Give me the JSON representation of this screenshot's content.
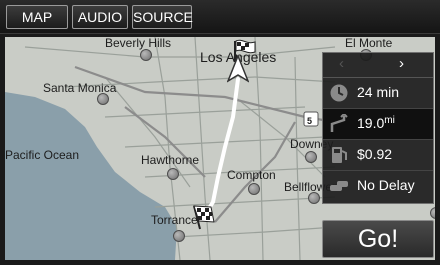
{
  "tabs": [
    {
      "label": "MAP"
    },
    {
      "label": "AUDIO"
    },
    {
      "label": "SOURCE"
    }
  ],
  "map": {
    "cities": [
      {
        "name": "Beverly Hills"
      },
      {
        "name": "Los Angeles"
      },
      {
        "name": "El Monte"
      },
      {
        "name": "Santa Monica"
      },
      {
        "name": "Pacific Ocean"
      },
      {
        "name": "Hawthorne"
      },
      {
        "name": "Compton"
      },
      {
        "name": "Bellflower"
      },
      {
        "name": "Downey"
      },
      {
        "name": "Torrance"
      }
    ],
    "highway_shield": "5",
    "colors": {
      "land": "#c9ccc6",
      "water": "#8a9faa",
      "route": "#ffffff"
    }
  },
  "route_panel": {
    "prev_icon": "chevron-left-icon",
    "next_icon": "chevron-right-icon",
    "time": "24 min",
    "distance": "19.0",
    "cost": "$0.92",
    "traffic": "No Delay"
  },
  "go_button": {
    "label": "Go!"
  }
}
